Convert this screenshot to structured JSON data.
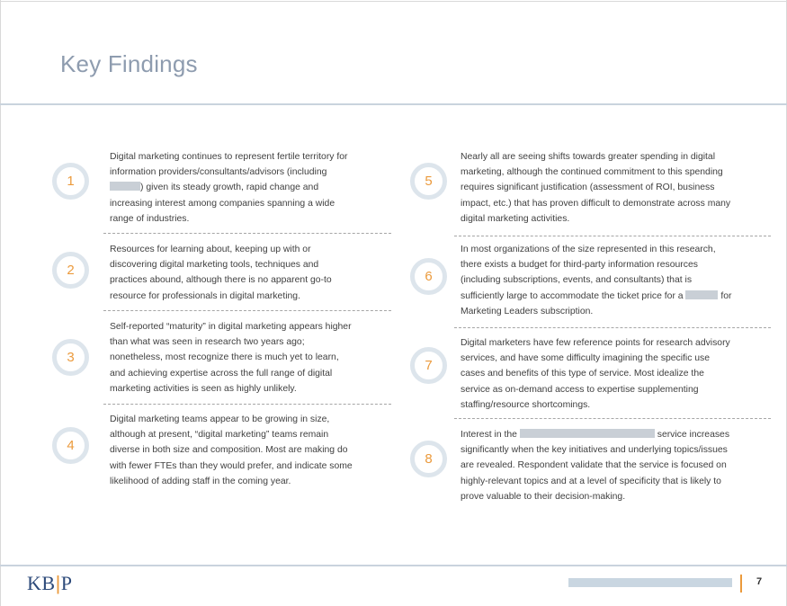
{
  "title": "Key Findings",
  "findings": [
    {
      "number": "1",
      "text": "Digital marketing continues to represent fertile territory for\ninformation providers/consultants/advisors (including\n"
    },
    {
      "number": "2",
      "text": "Resources for learning about, keeping up with or\ndiscovering digital marketing tools, techniques and\npractices abound, although there is no apparent go-to\nresource for professionals in digital marketing."
    },
    {
      "number": "3",
      "text": "Self-reported “maturity” in digital marketing appears higher\nthan what was seen in research two years ago;\nnonetheless, most recognize there is much yet to learn,\nand achieving expertise across the full range of digital\nmarketing activities is seen as highly unlikely."
    },
    {
      "number": "4",
      "text": "Digital marketing teams appear to be growing in size,\nalthough at present, “digital marketing” teams remain\ndiverse in both size and composition. Most are making do\nwith fewer FTEs than they would prefer, and indicate some\nlikelihood of adding staff in the coming year."
    },
    {
      "number": "5",
      "text": "Nearly all are seeing shifts towards greater spending in digital\nmarketing, although the continued commitment to this spending\nrequires significant justification (assessment of ROI, business\nimpact, etc.) that has proven difficult to demonstrate across many\ndigital marketing activities."
    },
    {
      "number": "6",
      "text": "In most organizations of the size represented in this research,\nthere exists a budget for third-party information resources\n(including subscriptions, events, and consultants) that is\nsufficiently large to accommodate the ticket price for a "
    },
    {
      "number": "7",
      "text": "Digital marketers have few reference points for research advisory\nservices, and have some difficulty imagining the specific use\ncases and benefits of this type of service. Most idealize the\nservice as on-demand access to expertise supplementing\nstaffing/resource shortcomings."
    },
    {
      "number": "8",
      "text": "Interest in the "
    }
  ],
  "finding1_rest": ") given its steady growth, rapid change and\nincreasing interest among companies spanning a wide\nrange of industries.",
  "finding6_rest": " for\nMarketing Leaders subscription.",
  "finding8_rest": " service increases\nsignificantly when the key initiatives and underlying topics/issues\nare revealed. Respondent validate that the service is focused on\nhighly-relevant topics and at a level of specificity that is likely to\nprove valuable to their decision-making.",
  "footer": {
    "logo_left": "KB",
    "logo_bar": "|",
    "logo_right": "P",
    "page_number": "7"
  },
  "colors": {
    "accent": "#eb9a3c",
    "title": "#8e9caf",
    "circle_ring": "#dde5ec",
    "logo": "#2d4a7a"
  }
}
